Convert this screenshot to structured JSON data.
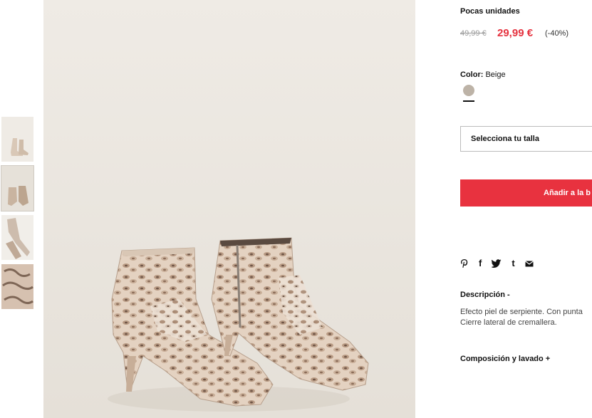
{
  "product": {
    "stock_label": "Pocas unidades",
    "old_price": "49,99 €",
    "new_price": "29,99 €",
    "discount": "(-40%)",
    "color_label": "Color:",
    "color_value": "Beige",
    "size_placeholder": "Selecciona tu talla",
    "add_button_label": "Añadir a la b",
    "description_title": "Descripción -",
    "description_lines": [
      "Efecto piel de serpiente. Con punta",
      "Cierre lateral de cremallera."
    ],
    "composition_title": "Composición y lavado +"
  },
  "share": {
    "icons": [
      "pinterest-icon",
      "facebook-icon",
      "twitter-icon",
      "tumblr-icon",
      "email-icon"
    ],
    "glyphs": [
      "",
      "f",
      "",
      "t",
      ""
    ]
  },
  "colors": {
    "accent": "#e8323f",
    "price": "#e5323f",
    "swatch_beige": "#bdb3a7",
    "image_background": "#ebe7e0"
  },
  "thumbnails": {
    "count": 4,
    "active_index": 1
  }
}
